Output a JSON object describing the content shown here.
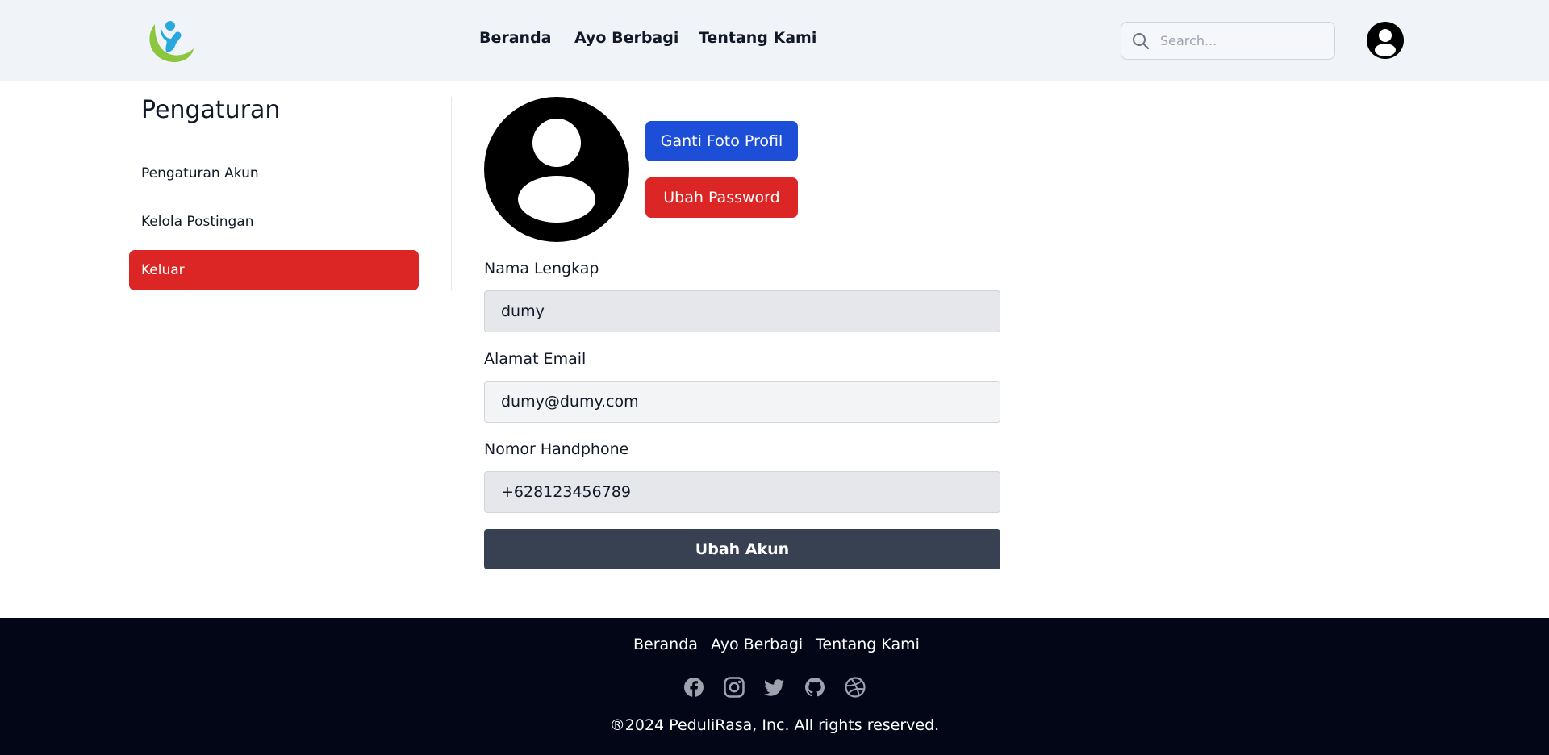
{
  "header": {
    "logo_alt": "PeduliRasa",
    "nav": [
      "Beranda",
      "Ayo Berbagi",
      "Tentang Kami"
    ],
    "search_placeholder": "Search...",
    "icons": {
      "search": "search-icon",
      "avatar": "user-avatar-icon"
    }
  },
  "sidebar": {
    "title": "Pengaturan",
    "items": [
      {
        "label": "Pengaturan Akun",
        "active": false
      },
      {
        "label": "Kelola Postingan",
        "active": false
      },
      {
        "label": "Keluar",
        "active": true,
        "color": "#dc2626"
      }
    ]
  },
  "profile": {
    "change_photo_label": "Ganti Foto Profil",
    "change_password_label": "Ubah Password",
    "fields": [
      {
        "label": "Nama Lengkap",
        "value": "dumy"
      },
      {
        "label": "Alamat Email",
        "value": "dumy@dumy.com"
      },
      {
        "label": "Nomor Handphone",
        "value": "+628123456789"
      }
    ],
    "submit_label": "Ubah Akun"
  },
  "footer": {
    "nav": [
      "Beranda",
      "Ayo Berbagi",
      "Tentang Kami"
    ],
    "social_icons": [
      "facebook-icon",
      "instagram-icon",
      "twitter-icon",
      "github-icon",
      "dribbble-icon"
    ],
    "copyright": "®2024 PeduliRasa, Inc. All rights reserved."
  },
  "colors": {
    "header_bg": "#f0f3f8",
    "primary_blue": "#1d4ed8",
    "danger_red": "#dc2626",
    "submit_dark": "#374151",
    "footer_bg": "#020617",
    "logo_green": "#8cc63f",
    "logo_blue": "#29a8e0"
  }
}
